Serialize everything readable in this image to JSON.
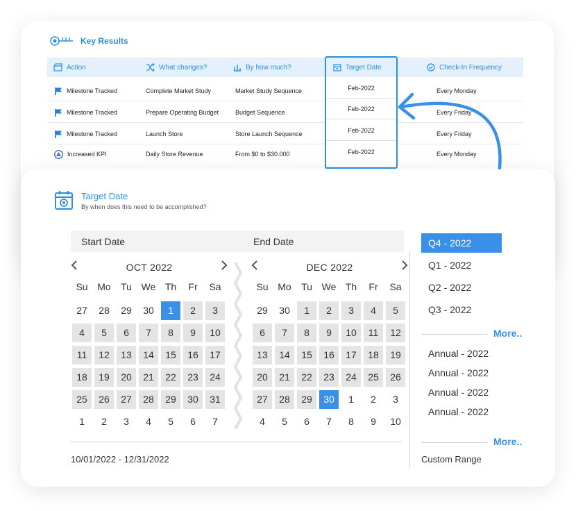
{
  "key_results": {
    "title": "Key Results",
    "headers": {
      "action": "Action",
      "what_changes": "What changes?",
      "by_how_much": "By how much?",
      "target_date": "Target Date",
      "checkin": "Check-In Frequency"
    },
    "rows": [
      {
        "action": "Milestone Tracked",
        "what": "Complete Market Study",
        "how_much": "Market Study Sequence",
        "date": "Feb-2022",
        "freq": "Every Monday",
        "icon": "flag-icon"
      },
      {
        "action": "Milestone Tracked",
        "what": "Prepare Operating Budget",
        "how_much": "Budget Sequence",
        "date": "Feb-2022",
        "freq": "Every Friday",
        "icon": "flag-icon"
      },
      {
        "action": "Milestone Tracked",
        "what": "Launch Store",
        "how_much": "Store Launch Sequence",
        "date": "Feb-2022",
        "freq": "Every Friday",
        "icon": "flag-icon"
      },
      {
        "action": "Increased KPI",
        "what": "Daily Store Revenue",
        "how_much": "From $0 to $30.000",
        "date": "Feb-2022",
        "freq": "Every Monday",
        "icon": "triangle-up-icon"
      }
    ]
  },
  "target_date": {
    "title": "Target Date",
    "subtitle": "By when does this need to be accomplished?",
    "start_label": "Start Date",
    "end_label": "End Date",
    "weekdays": [
      "Su",
      "Mo",
      "Tu",
      "We",
      "Th",
      "Fr",
      "Sa"
    ],
    "start_calendar": {
      "month": "OCT 2022",
      "days": [
        {
          "d": "27",
          "s": "out"
        },
        {
          "d": "28",
          "s": "out"
        },
        {
          "d": "29",
          "s": "out"
        },
        {
          "d": "30",
          "s": "out"
        },
        {
          "d": "1",
          "s": "sel"
        },
        {
          "d": "2",
          "s": "in"
        },
        {
          "d": "3",
          "s": "in"
        },
        {
          "d": "4",
          "s": "in"
        },
        {
          "d": "5",
          "s": "in"
        },
        {
          "d": "6",
          "s": "in"
        },
        {
          "d": "7",
          "s": "in"
        },
        {
          "d": "8",
          "s": "in"
        },
        {
          "d": "9",
          "s": "in"
        },
        {
          "d": "10",
          "s": "in"
        },
        {
          "d": "11",
          "s": "in"
        },
        {
          "d": "12",
          "s": "in"
        },
        {
          "d": "13",
          "s": "in"
        },
        {
          "d": "14",
          "s": "in"
        },
        {
          "d": "15",
          "s": "in"
        },
        {
          "d": "16",
          "s": "in"
        },
        {
          "d": "17",
          "s": "in"
        },
        {
          "d": "18",
          "s": "in"
        },
        {
          "d": "19",
          "s": "in"
        },
        {
          "d": "20",
          "s": "in"
        },
        {
          "d": "21",
          "s": "in"
        },
        {
          "d": "22",
          "s": "in"
        },
        {
          "d": "23",
          "s": "in"
        },
        {
          "d": "24",
          "s": "in"
        },
        {
          "d": "25",
          "s": "in"
        },
        {
          "d": "26",
          "s": "in"
        },
        {
          "d": "27",
          "s": "in"
        },
        {
          "d": "28",
          "s": "in"
        },
        {
          "d": "29",
          "s": "in"
        },
        {
          "d": "30",
          "s": "in"
        },
        {
          "d": "31",
          "s": "in"
        },
        {
          "d": "1",
          "s": "out"
        },
        {
          "d": "2",
          "s": "out"
        },
        {
          "d": "3",
          "s": "out"
        },
        {
          "d": "4",
          "s": "out"
        },
        {
          "d": "5",
          "s": "out"
        },
        {
          "d": "6",
          "s": "out"
        },
        {
          "d": "7",
          "s": "out"
        }
      ]
    },
    "end_calendar": {
      "month": "DEC 2022",
      "days": [
        {
          "d": "29",
          "s": "out"
        },
        {
          "d": "30",
          "s": "out"
        },
        {
          "d": "1",
          "s": "in"
        },
        {
          "d": "2",
          "s": "in"
        },
        {
          "d": "3",
          "s": "in"
        },
        {
          "d": "4",
          "s": "in"
        },
        {
          "d": "5",
          "s": "in"
        },
        {
          "d": "6",
          "s": "in"
        },
        {
          "d": "7",
          "s": "in"
        },
        {
          "d": "8",
          "s": "in"
        },
        {
          "d": "9",
          "s": "in"
        },
        {
          "d": "10",
          "s": "in"
        },
        {
          "d": "11",
          "s": "in"
        },
        {
          "d": "12",
          "s": "in"
        },
        {
          "d": "13",
          "s": "in"
        },
        {
          "d": "14",
          "s": "in"
        },
        {
          "d": "15",
          "s": "in"
        },
        {
          "d": "16",
          "s": "in"
        },
        {
          "d": "17",
          "s": "in"
        },
        {
          "d": "18",
          "s": "in"
        },
        {
          "d": "19",
          "s": "in"
        },
        {
          "d": "20",
          "s": "in"
        },
        {
          "d": "21",
          "s": "in"
        },
        {
          "d": "22",
          "s": "in"
        },
        {
          "d": "23",
          "s": "in"
        },
        {
          "d": "24",
          "s": "in"
        },
        {
          "d": "25",
          "s": "in"
        },
        {
          "d": "26",
          "s": "in"
        },
        {
          "d": "27",
          "s": "in"
        },
        {
          "d": "28",
          "s": "in"
        },
        {
          "d": "29",
          "s": "in"
        },
        {
          "d": "30",
          "s": "sel"
        },
        {
          "d": "1",
          "s": "out"
        },
        {
          "d": "2",
          "s": "out"
        },
        {
          "d": "3",
          "s": "out"
        },
        {
          "d": "4",
          "s": "out"
        },
        {
          "d": "5",
          "s": "out"
        },
        {
          "d": "6",
          "s": "out"
        },
        {
          "d": "7",
          "s": "out"
        },
        {
          "d": "8",
          "s": "out"
        },
        {
          "d": "9",
          "s": "out"
        },
        {
          "d": "10",
          "s": "out"
        }
      ]
    },
    "range_text": "10/01/2022 - 12/31/2022",
    "quarters": [
      "Q4 -  2022",
      "Q1 -  2022",
      "Q2 -  2022",
      "Q3 -  2022"
    ],
    "quarters_selected": 0,
    "more_label": "More..",
    "annuals": [
      "Annual - 2022",
      "Annual - 2022",
      "Annual - 2022",
      "Annual - 2022"
    ],
    "custom_range": "Custom Range"
  },
  "colors": {
    "accent": "#2b8fe0",
    "selected": "#3a8fe6",
    "range_fill": "#e4e4e4",
    "header_bg": "#e4f0fb"
  }
}
